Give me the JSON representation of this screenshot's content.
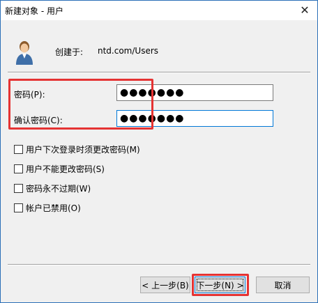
{
  "window": {
    "title": "新建对象 - 用户",
    "close_glyph": "✕"
  },
  "created_in": {
    "label": "创建于:",
    "value": "ntd.com/Users"
  },
  "fields": {
    "password_label": "密码(P):",
    "password_value": "●●●●●●●",
    "confirm_label": "确认密码(C):",
    "confirm_value": "●●●●●●●"
  },
  "options": [
    {
      "label": "用户下次登录时须更改密码(M)",
      "checked": false
    },
    {
      "label": "用户不能更改密码(S)",
      "checked": false
    },
    {
      "label": "密码永不过期(W)",
      "checked": false
    },
    {
      "label": "帐户已禁用(O)",
      "checked": false
    }
  ],
  "buttons": {
    "back": "< 上一步(B)",
    "next": "下一步(N) >",
    "cancel": "取消"
  },
  "colors": {
    "highlight": "#e53333",
    "focus": "#0078d7",
    "title_border": "#2b6fb8"
  },
  "icons": {
    "user": "user-icon",
    "close": "close-icon"
  }
}
